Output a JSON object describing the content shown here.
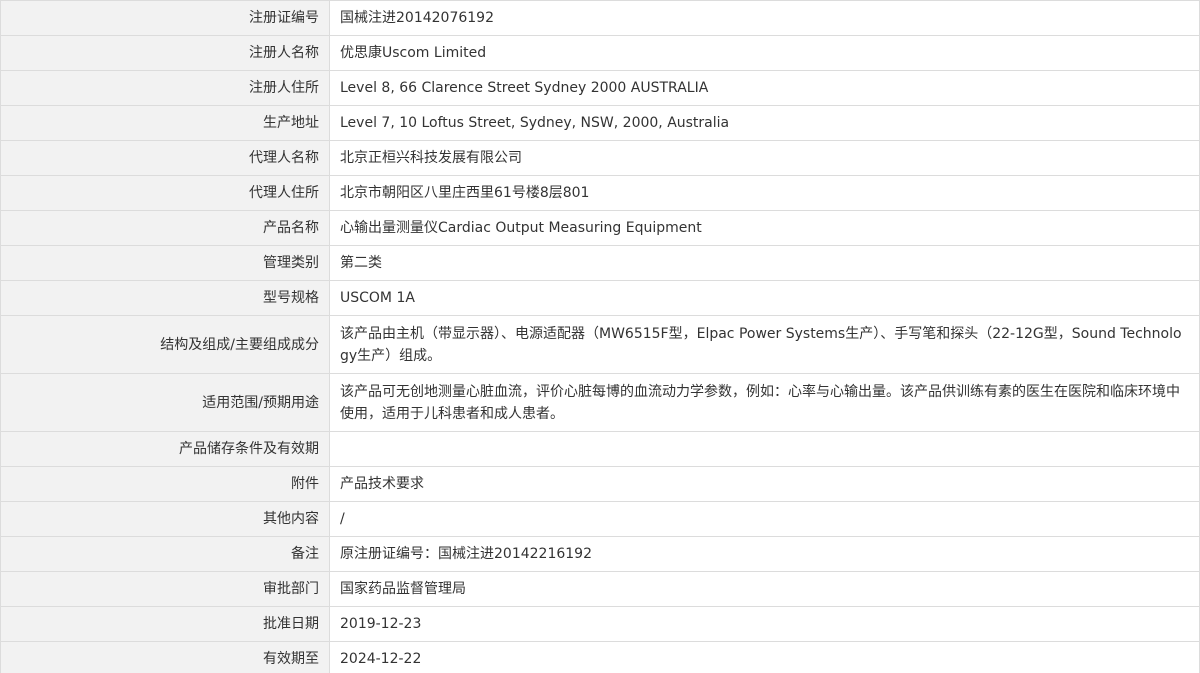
{
  "rows": [
    {
      "label": "注册证编号",
      "value": "国械注进20142076192"
    },
    {
      "label": "注册人名称",
      "value": "优思康Uscom Limited"
    },
    {
      "label": "注册人住所",
      "value": "Level 8, 66 Clarence Street Sydney 2000 AUSTRALIA"
    },
    {
      "label": "生产地址",
      "value": "Level 7, 10 Loftus Street, Sydney, NSW, 2000, Australia"
    },
    {
      "label": "代理人名称",
      "value": "北京正桓兴科技发展有限公司"
    },
    {
      "label": "代理人住所",
      "value": "北京市朝阳区八里庄西里61号楼8层801"
    },
    {
      "label": "产品名称",
      "value": "心输出量测量仪Cardiac Output Measuring Equipment"
    },
    {
      "label": "管理类别",
      "value": "第二类"
    },
    {
      "label": "型号规格",
      "value": "USCOM 1A"
    },
    {
      "label": "结构及组成/主要组成成分",
      "value": "该产品由主机（带显示器）、电源适配器（MW6515F型，Elpac Power Systems生产）、手写笔和探头（22-12G型，Sound Technology生产）组成。"
    },
    {
      "label": "适用范围/预期用途",
      "value": "该产品可无创地测量心脏血流，评价心脏每博的血流动力学参数，例如：心率与心输出量。该产品供训练有素的医生在医院和临床环境中使用，适用于儿科患者和成人患者。"
    },
    {
      "label": "产品储存条件及有效期",
      "value": ""
    },
    {
      "label": "附件",
      "value": "产品技术要求"
    },
    {
      "label": "其他内容",
      "value": "/"
    },
    {
      "label": "备注",
      "value": "原注册证编号：国械注进20142216192"
    },
    {
      "label": "审批部门",
      "value": "国家药品监督管理局"
    },
    {
      "label": "批准日期",
      "value": "2019-12-23"
    },
    {
      "label": "有效期至",
      "value": "2024-12-22"
    }
  ]
}
